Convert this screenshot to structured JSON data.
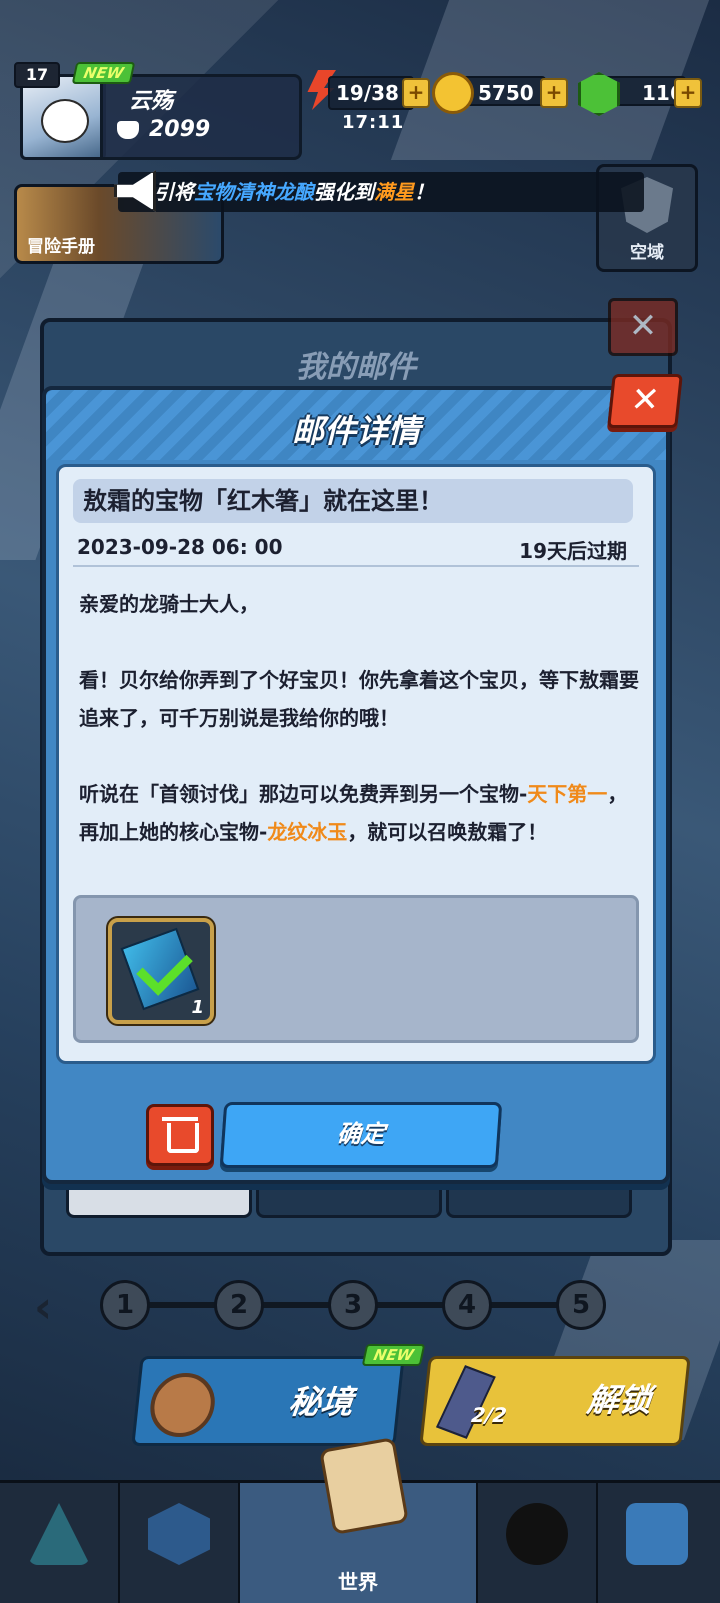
{
  "hud": {
    "level": "17",
    "new_badge": "NEW",
    "player_name": "云殇",
    "power": "2099",
    "stamina": "19/38",
    "gold": "5750",
    "gems": "116",
    "plus": "+",
    "timer": "17:11"
  },
  "announcement": {
    "prefix": "引将",
    "item": "宝物清神龙酿",
    "mid": "强化到",
    "level": "满星",
    "suffix": "！"
  },
  "side": {
    "adventure_book": "冒险手册",
    "sky_domain": "空域"
  },
  "back_panel": {
    "title": "我的邮件",
    "close": "✕"
  },
  "modal": {
    "title": "邮件详情",
    "close": "✕",
    "subject": "敖霜的宝物「红木箸」就在这里！",
    "date": "2023-09-28 06: 00",
    "expire": "19天后过期",
    "greeting": "亲爱的龙骑士大人，",
    "para1": "看！贝尔给你弄到了个好宝贝！你先拿着这个宝贝，等下敖霜要追来了，可千万别说是我给你的哦！",
    "para2_a": "听说在「首领讨伐」那边可以免费弄到另一个宝物-",
    "para2_hl1": "天下第一",
    "para2_b": "，再加上她的核心宝物-",
    "para2_hl2": "龙纹冰玉",
    "para2_c": "，就可以召唤敖霜了！",
    "attachment_count": "1",
    "confirm": "确定"
  },
  "stages": [
    "1",
    "2",
    "3",
    "4",
    "5"
  ],
  "lower": {
    "secret_realm": "秘境",
    "new_badge": "NEW",
    "unlock_count": "2/2",
    "unlock": "解锁"
  },
  "nav": {
    "world": "世界"
  },
  "colors": {
    "highlight_orange": "#f08a1a",
    "announce_blue": "#46a8ff",
    "confirm_blue": "#3ea6f5",
    "close_red": "#e84a2c"
  }
}
